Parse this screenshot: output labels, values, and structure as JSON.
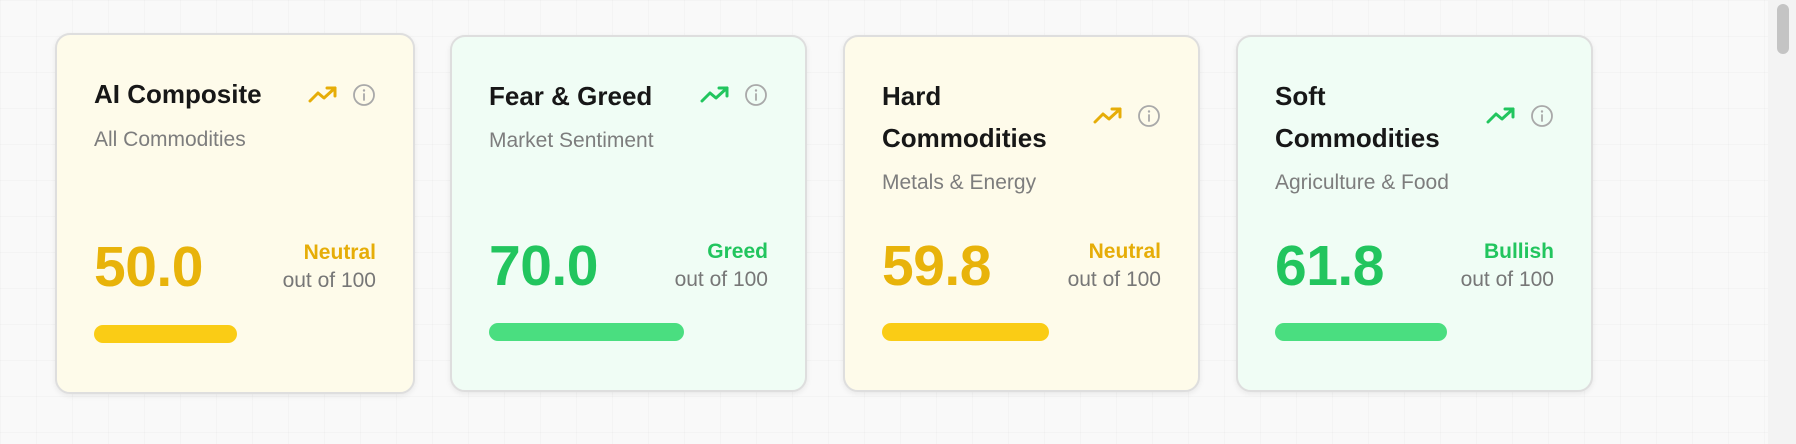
{
  "cards": [
    {
      "title": "AI Composite",
      "subtitle": "All Commodities",
      "score": "50.0",
      "label": "Neutral",
      "scale": "out of 100",
      "theme": "yellow",
      "progress_percent": 50,
      "trend_icon": "trending-up-icon",
      "info_icon": "info-icon",
      "color": "#e8b30a"
    },
    {
      "title": "Fear & Greed",
      "subtitle": "Market Sentiment",
      "score": "70.0",
      "label": "Greed",
      "scale": "out of 100",
      "theme": "green",
      "progress_percent": 70,
      "trend_icon": "trending-up-icon",
      "info_icon": "info-icon",
      "color": "#22c55e"
    },
    {
      "title": "Hard Commodities",
      "subtitle": "Metals & Energy",
      "score": "59.8",
      "label": "Neutral",
      "scale": "out of 100",
      "theme": "yellow",
      "progress_percent": 59.8,
      "trend_icon": "trending-up-icon",
      "info_icon": "info-icon",
      "color": "#e8b30a"
    },
    {
      "title": "Soft Commodities",
      "subtitle": "Agriculture & Food",
      "score": "61.8",
      "label": "Bullish",
      "scale": "out of 100",
      "theme": "green",
      "progress_percent": 61.8,
      "trend_icon": "trending-up-icon",
      "info_icon": "info-icon",
      "color": "#22c55e"
    }
  ]
}
